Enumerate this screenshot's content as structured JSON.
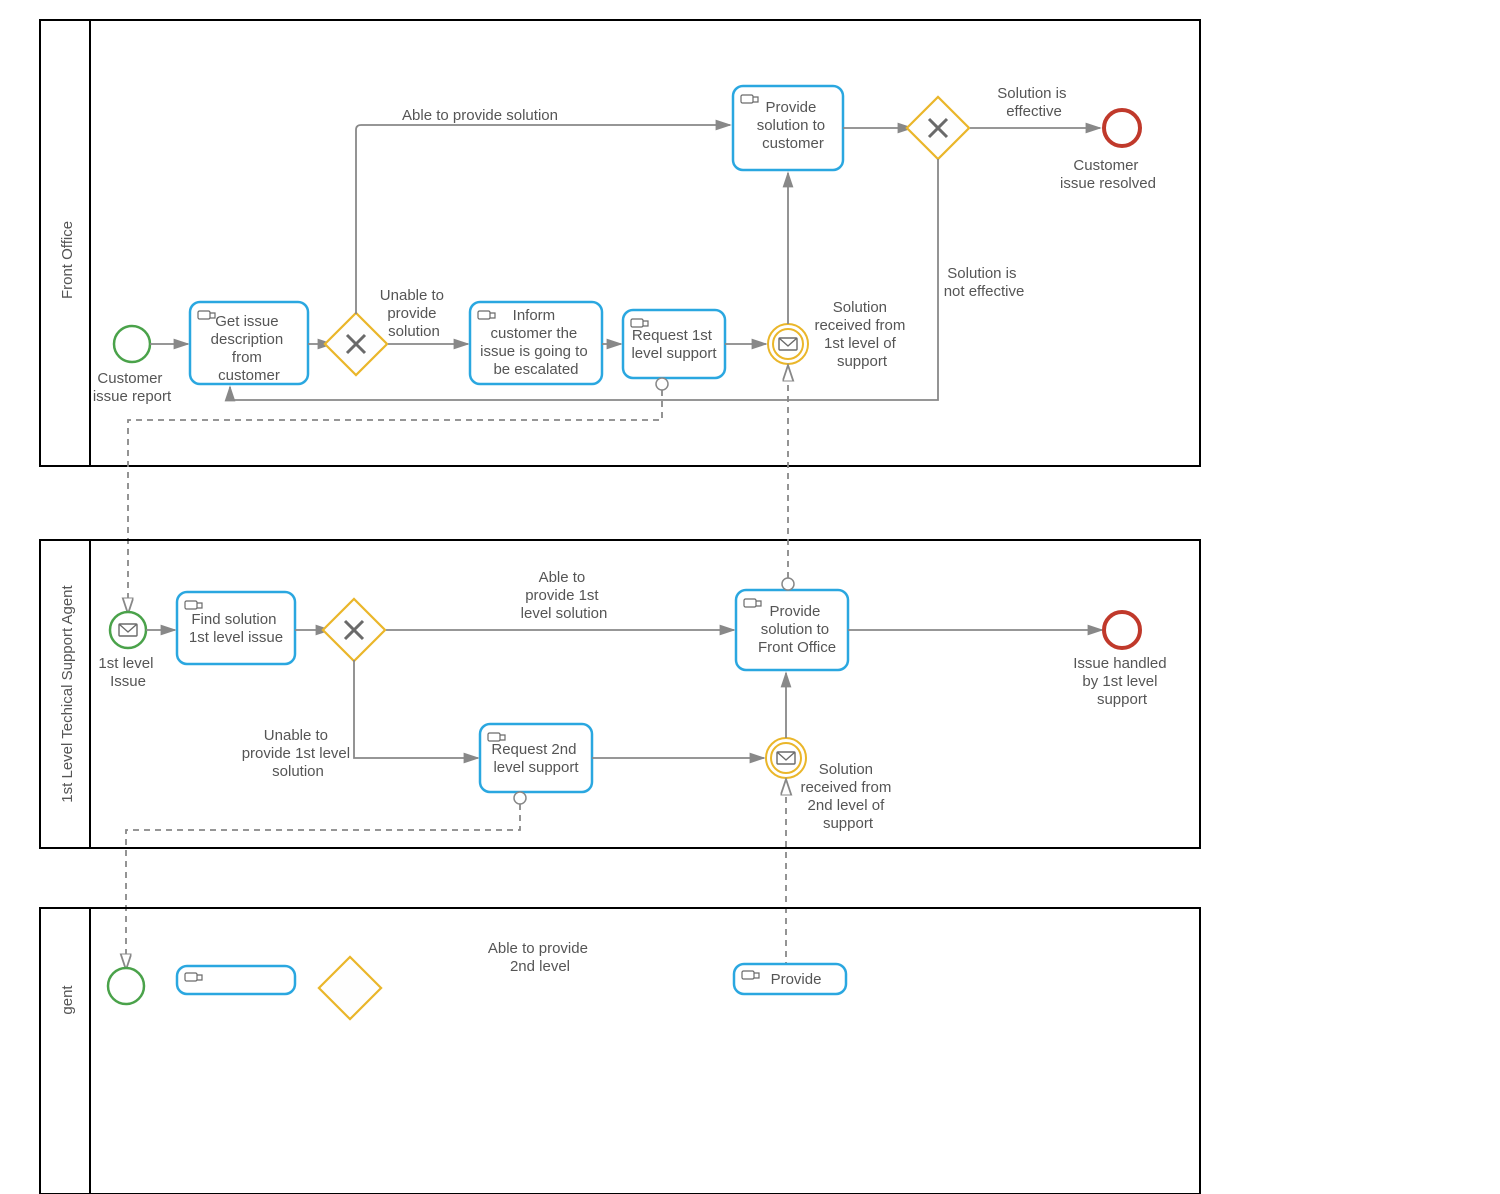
{
  "pools": {
    "frontOffice": "Front Office",
    "l1Agent": "1st Level Techical Support Agent"
  },
  "events": {
    "custReport": "Customer issue report",
    "l1Issue": "1st level Issue"
  },
  "tasks": {
    "getIssue": "Get issue description from customer",
    "inform": "Inform customer the issue is going to be escalated",
    "req1": "Request 1st level support",
    "provCust": "Provide solution to customer",
    "findL1": "Find solution 1st level issue",
    "req2": "Request 2nd level support",
    "provFO": "Provide solution to Front Office",
    "provL2": "Provide"
  },
  "intermediate": {
    "solL1": "Solution received from 1st level of support",
    "solL2": "Solution received from 2nd level of support"
  },
  "end": {
    "resolved": "Customer issue resolved",
    "handledL1": "Issue handled by 1st level support"
  },
  "labels": {
    "ableSolution": "Able to provide solution",
    "unableSolution": "Unable to provide solution",
    "effective": "Solution is effective",
    "notEffective": "Solution is not effective",
    "ableL1": "Able to provide 1st level solution",
    "unableL1": "Unable to provide 1st level solution",
    "ableL2": "Able to provide 2nd level"
  }
}
